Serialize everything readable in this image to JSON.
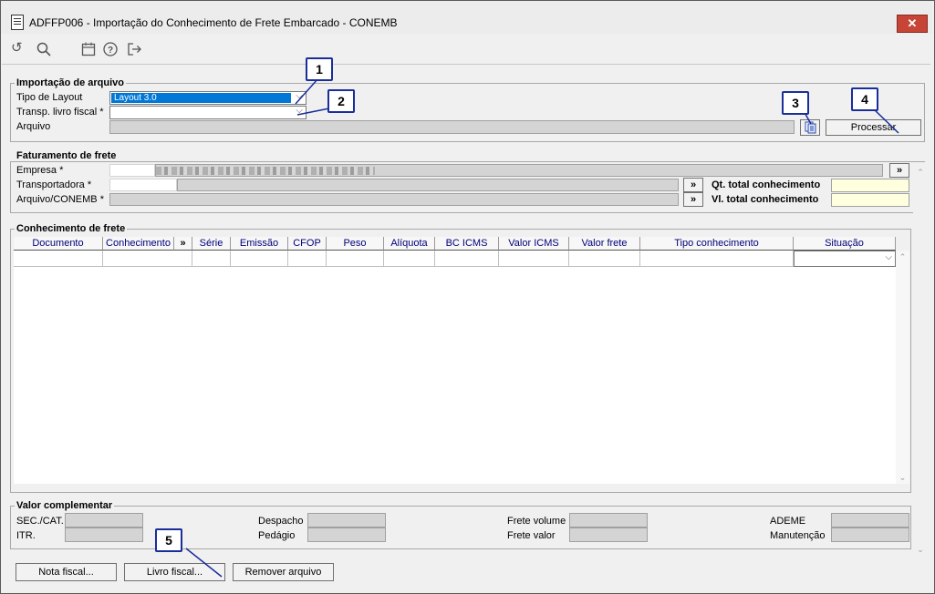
{
  "window": {
    "title": "ADFFP006 - Importação do Conhecimento de Frete Embarcado - CONEMB",
    "close_symbol": "✕"
  },
  "toolbar": {
    "icons": [
      "undo-icon",
      "search-icon",
      "calendar-icon",
      "help-icon",
      "exit-icon"
    ]
  },
  "importacao": {
    "title": "Importação de arquivo",
    "tipo_layout_label": "Tipo de Layout",
    "tipo_layout_value": "Layout 3.0",
    "transp_livro_label": "Transp. livro fiscal *",
    "transp_livro_value": "",
    "arquivo_label": "Arquivo",
    "arquivo_value": "",
    "processar_label": "Processar"
  },
  "faturamento": {
    "title": "Faturamento de frete",
    "empresa_label": "Empresa *",
    "transportadora_label": "Transportadora *",
    "arquivo_conemb_label": "Arquivo/CONEMB *",
    "more_label": "»",
    "qt_total_label": "Qt. total conhecimento",
    "qt_total_value": "",
    "vl_total_label": "Vl. total conhecimento",
    "vl_total_value": ""
  },
  "conhecimento": {
    "title": "Conhecimento de frete",
    "columns": [
      "Documento",
      "Conhecimento",
      "»",
      "Série",
      "Emissão",
      "CFOP",
      "Peso",
      "Alíquota",
      "BC ICMS",
      "Valor ICMS",
      "Valor frete",
      "Tipo conhecimento",
      "Situação"
    ]
  },
  "complementar": {
    "title": "Valor complementar",
    "fields": [
      {
        "label": "SEC./CAT.",
        "value": ""
      },
      {
        "label": "ITR.",
        "value": ""
      },
      {
        "label": "Despacho",
        "value": ""
      },
      {
        "label": "Pedágio",
        "value": ""
      },
      {
        "label": "Frete volume",
        "value": ""
      },
      {
        "label": "Frete valor",
        "value": ""
      },
      {
        "label": "ADEME",
        "value": ""
      },
      {
        "label": "Manutenção",
        "value": ""
      }
    ]
  },
  "footer": {
    "nota_fiscal_label": "Nota fiscal...",
    "livro_fiscal_label": "Livro fiscal...",
    "remover_arquivo_label": "Remover arquivo"
  },
  "callouts": [
    "1",
    "2",
    "3",
    "4",
    "5"
  ],
  "colors": {
    "callout_border": "#1a2e9a",
    "selection": "#0078d7",
    "close_button": "#c74537",
    "readonly_field": "#d4d4d4",
    "total_field": "#ffffe0"
  }
}
